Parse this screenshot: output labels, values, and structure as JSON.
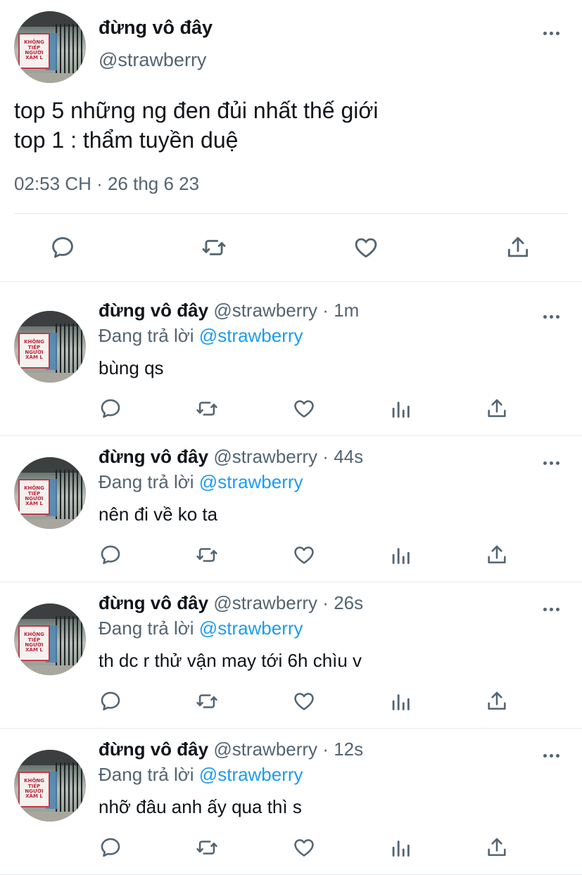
{
  "main_tweet": {
    "name": "đừng vô đây",
    "handle": "@strawberry",
    "text_lines": [
      "top 5 những ng đen đủi nhất thế giới",
      "top 1 : thẩm tuyền duệ"
    ],
    "timestamp": "02:53 CH · 26 thg 6 23",
    "avatar_sign": "KHÔNG TIẾP NGƯỜI XÀM L",
    "actions": [
      "reply-icon",
      "retweet-icon",
      "like-icon",
      "share-icon"
    ]
  },
  "replies": [
    {
      "name": "đừng vô đây",
      "handle": "@strawberry",
      "sep": "·",
      "time": "1m",
      "replying_label": "Đang trả lời",
      "replying_to": "@strawberry",
      "text": "bùng qs"
    },
    {
      "name": "đừng vô đây",
      "handle": "@strawberry",
      "sep": "·",
      "time": "44s",
      "replying_label": "Đang trả lời",
      "replying_to": "@strawberry",
      "text": "nên đi về ko ta"
    },
    {
      "name": "đừng vô đây",
      "handle": "@strawberry",
      "sep": "·",
      "time": "26s",
      "replying_label": "Đang trả lời",
      "replying_to": "@strawberry",
      "text": "th dc r thử vận may tới 6h chìu v"
    },
    {
      "name": "đừng vô đây",
      "handle": "@strawberry",
      "sep": "·",
      "time": "12s",
      "replying_label": "Đang trả lời",
      "replying_to": "@strawberry",
      "text": "nhỡ đâu anh ấy qua thì s"
    }
  ],
  "reply_actions": [
    "reply-icon",
    "retweet-icon",
    "like-icon",
    "analytics-icon",
    "share-icon"
  ],
  "colors": {
    "text": "#0f1419",
    "secondary": "#536471",
    "link": "#1d9bf0",
    "separator": "#e6e9ec"
  }
}
